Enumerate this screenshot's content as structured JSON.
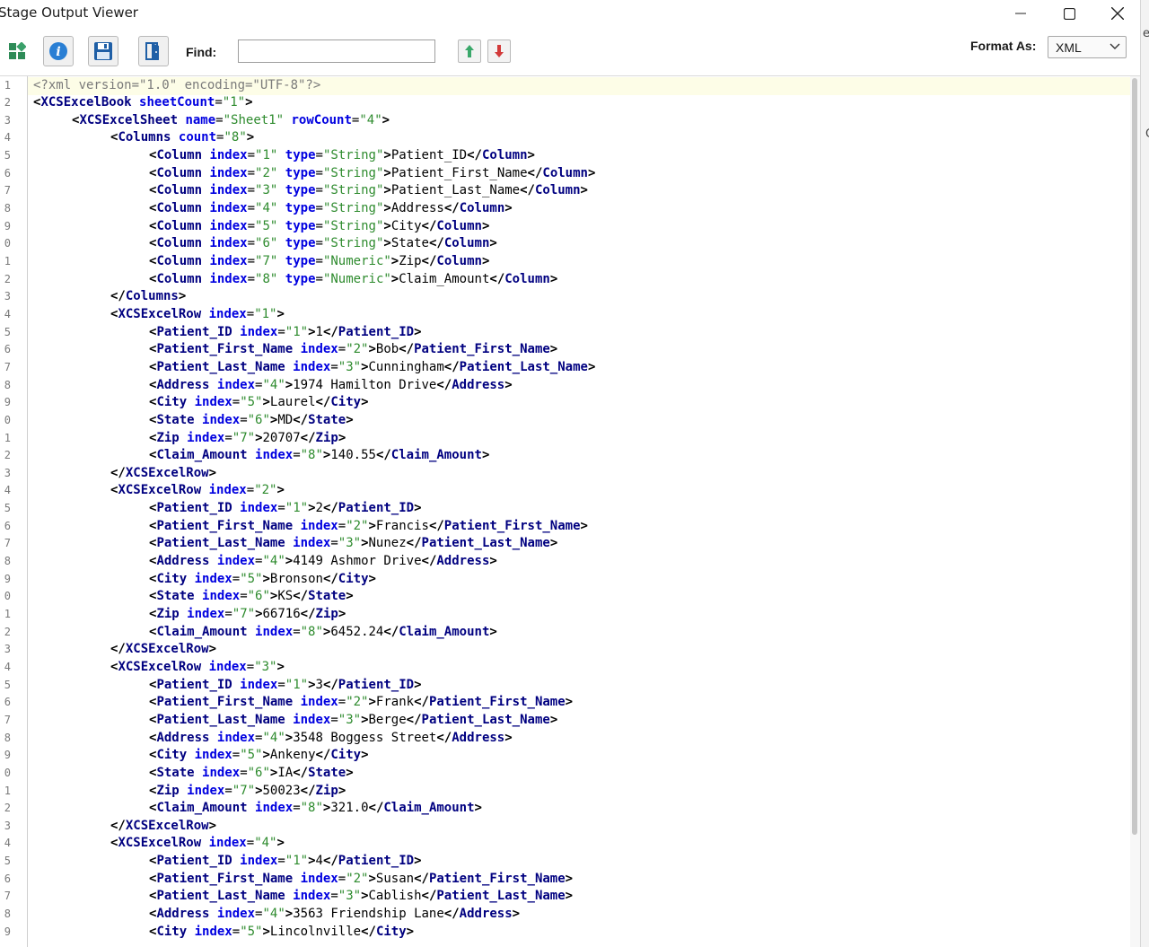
{
  "window": {
    "title": "Stage Output Viewer"
  },
  "toolbar": {
    "find_label": "Find:",
    "find_value": "",
    "format_label": "Format As:",
    "format_value": "XML"
  },
  "background_strip": [
    "e",
    "C"
  ],
  "colors": {
    "tag": "#000080",
    "attribute": "#0000e0",
    "value": "#2e8b2e",
    "declaration": "#7a7a7a",
    "current_line": "#fdfde7"
  },
  "editor": {
    "line_numbers": [
      "1",
      "2",
      "3",
      "4",
      "5",
      "6",
      "7",
      "8",
      "9",
      "0",
      "1",
      "2",
      "3",
      "4",
      "5",
      "6",
      "7",
      "8",
      "9",
      "0",
      "1",
      "2",
      "3",
      "4",
      "5",
      "6",
      "7",
      "8",
      "9",
      "0",
      "1",
      "2",
      "3",
      "4",
      "5",
      "6",
      "7",
      "8",
      "9",
      "0",
      "1",
      "2",
      "3",
      "4",
      "5",
      "6",
      "7",
      "8",
      "9"
    ],
    "lines": [
      {
        "indent": 0,
        "kind": "decl",
        "text": "<?xml version=\"1.0\" encoding=\"UTF-8\"?>"
      },
      {
        "indent": 0,
        "kind": "open",
        "tag": "XCSExcelBook",
        "attrs": [
          [
            "sheetCount",
            "1"
          ]
        ]
      },
      {
        "indent": 1,
        "kind": "open",
        "tag": "XCSExcelSheet",
        "attrs": [
          [
            "name",
            "Sheet1"
          ],
          [
            "rowCount",
            "4"
          ]
        ]
      },
      {
        "indent": 2,
        "kind": "open",
        "tag": "Columns",
        "attrs": [
          [
            "count",
            "8"
          ]
        ]
      },
      {
        "indent": 3,
        "kind": "elem",
        "tag": "Column",
        "attrs": [
          [
            "index",
            "1"
          ],
          [
            "type",
            "String"
          ]
        ],
        "text": "Patient_ID"
      },
      {
        "indent": 3,
        "kind": "elem",
        "tag": "Column",
        "attrs": [
          [
            "index",
            "2"
          ],
          [
            "type",
            "String"
          ]
        ],
        "text": "Patient_First_Name"
      },
      {
        "indent": 3,
        "kind": "elem",
        "tag": "Column",
        "attrs": [
          [
            "index",
            "3"
          ],
          [
            "type",
            "String"
          ]
        ],
        "text": "Patient_Last_Name"
      },
      {
        "indent": 3,
        "kind": "elem",
        "tag": "Column",
        "attrs": [
          [
            "index",
            "4"
          ],
          [
            "type",
            "String"
          ]
        ],
        "text": "Address"
      },
      {
        "indent": 3,
        "kind": "elem",
        "tag": "Column",
        "attrs": [
          [
            "index",
            "5"
          ],
          [
            "type",
            "String"
          ]
        ],
        "text": "City"
      },
      {
        "indent": 3,
        "kind": "elem",
        "tag": "Column",
        "attrs": [
          [
            "index",
            "6"
          ],
          [
            "type",
            "String"
          ]
        ],
        "text": "State"
      },
      {
        "indent": 3,
        "kind": "elem",
        "tag": "Column",
        "attrs": [
          [
            "index",
            "7"
          ],
          [
            "type",
            "Numeric"
          ]
        ],
        "text": "Zip"
      },
      {
        "indent": 3,
        "kind": "elem",
        "tag": "Column",
        "attrs": [
          [
            "index",
            "8"
          ],
          [
            "type",
            "Numeric"
          ]
        ],
        "text": "Claim_Amount"
      },
      {
        "indent": 2,
        "kind": "close",
        "tag": "Columns"
      },
      {
        "indent": 2,
        "kind": "open",
        "tag": "XCSExcelRow",
        "attrs": [
          [
            "index",
            "1"
          ]
        ]
      },
      {
        "indent": 3,
        "kind": "elem",
        "tag": "Patient_ID",
        "attrs": [
          [
            "index",
            "1"
          ]
        ],
        "text": "1"
      },
      {
        "indent": 3,
        "kind": "elem",
        "tag": "Patient_First_Name",
        "attrs": [
          [
            "index",
            "2"
          ]
        ],
        "text": "Bob"
      },
      {
        "indent": 3,
        "kind": "elem",
        "tag": "Patient_Last_Name",
        "attrs": [
          [
            "index",
            "3"
          ]
        ],
        "text": "Cunningham"
      },
      {
        "indent": 3,
        "kind": "elem",
        "tag": "Address",
        "attrs": [
          [
            "index",
            "4"
          ]
        ],
        "text": "1974 Hamilton Drive"
      },
      {
        "indent": 3,
        "kind": "elem",
        "tag": "City",
        "attrs": [
          [
            "index",
            "5"
          ]
        ],
        "text": "Laurel"
      },
      {
        "indent": 3,
        "kind": "elem",
        "tag": "State",
        "attrs": [
          [
            "index",
            "6"
          ]
        ],
        "text": "MD"
      },
      {
        "indent": 3,
        "kind": "elem",
        "tag": "Zip",
        "attrs": [
          [
            "index",
            "7"
          ]
        ],
        "text": "20707"
      },
      {
        "indent": 3,
        "kind": "elem",
        "tag": "Claim_Amount",
        "attrs": [
          [
            "index",
            "8"
          ]
        ],
        "text": "140.55"
      },
      {
        "indent": 2,
        "kind": "close",
        "tag": "XCSExcelRow"
      },
      {
        "indent": 2,
        "kind": "open",
        "tag": "XCSExcelRow",
        "attrs": [
          [
            "index",
            "2"
          ]
        ]
      },
      {
        "indent": 3,
        "kind": "elem",
        "tag": "Patient_ID",
        "attrs": [
          [
            "index",
            "1"
          ]
        ],
        "text": "2"
      },
      {
        "indent": 3,
        "kind": "elem",
        "tag": "Patient_First_Name",
        "attrs": [
          [
            "index",
            "2"
          ]
        ],
        "text": "Francis"
      },
      {
        "indent": 3,
        "kind": "elem",
        "tag": "Patient_Last_Name",
        "attrs": [
          [
            "index",
            "3"
          ]
        ],
        "text": "Nunez"
      },
      {
        "indent": 3,
        "kind": "elem",
        "tag": "Address",
        "attrs": [
          [
            "index",
            "4"
          ]
        ],
        "text": "4149 Ashmor Drive"
      },
      {
        "indent": 3,
        "kind": "elem",
        "tag": "City",
        "attrs": [
          [
            "index",
            "5"
          ]
        ],
        "text": "Bronson"
      },
      {
        "indent": 3,
        "kind": "elem",
        "tag": "State",
        "attrs": [
          [
            "index",
            "6"
          ]
        ],
        "text": "KS"
      },
      {
        "indent": 3,
        "kind": "elem",
        "tag": "Zip",
        "attrs": [
          [
            "index",
            "7"
          ]
        ],
        "text": "66716"
      },
      {
        "indent": 3,
        "kind": "elem",
        "tag": "Claim_Amount",
        "attrs": [
          [
            "index",
            "8"
          ]
        ],
        "text": "6452.24"
      },
      {
        "indent": 2,
        "kind": "close",
        "tag": "XCSExcelRow"
      },
      {
        "indent": 2,
        "kind": "open",
        "tag": "XCSExcelRow",
        "attrs": [
          [
            "index",
            "3"
          ]
        ]
      },
      {
        "indent": 3,
        "kind": "elem",
        "tag": "Patient_ID",
        "attrs": [
          [
            "index",
            "1"
          ]
        ],
        "text": "3"
      },
      {
        "indent": 3,
        "kind": "elem",
        "tag": "Patient_First_Name",
        "attrs": [
          [
            "index",
            "2"
          ]
        ],
        "text": "Frank"
      },
      {
        "indent": 3,
        "kind": "elem",
        "tag": "Patient_Last_Name",
        "attrs": [
          [
            "index",
            "3"
          ]
        ],
        "text": "Berge"
      },
      {
        "indent": 3,
        "kind": "elem",
        "tag": "Address",
        "attrs": [
          [
            "index",
            "4"
          ]
        ],
        "text": "3548 Boggess Street"
      },
      {
        "indent": 3,
        "kind": "elem",
        "tag": "City",
        "attrs": [
          [
            "index",
            "5"
          ]
        ],
        "text": "Ankeny"
      },
      {
        "indent": 3,
        "kind": "elem",
        "tag": "State",
        "attrs": [
          [
            "index",
            "6"
          ]
        ],
        "text": "IA"
      },
      {
        "indent": 3,
        "kind": "elem",
        "tag": "Zip",
        "attrs": [
          [
            "index",
            "7"
          ]
        ],
        "text": "50023"
      },
      {
        "indent": 3,
        "kind": "elem",
        "tag": "Claim_Amount",
        "attrs": [
          [
            "index",
            "8"
          ]
        ],
        "text": "321.0"
      },
      {
        "indent": 2,
        "kind": "close",
        "tag": "XCSExcelRow"
      },
      {
        "indent": 2,
        "kind": "open",
        "tag": "XCSExcelRow",
        "attrs": [
          [
            "index",
            "4"
          ]
        ]
      },
      {
        "indent": 3,
        "kind": "elem",
        "tag": "Patient_ID",
        "attrs": [
          [
            "index",
            "1"
          ]
        ],
        "text": "4"
      },
      {
        "indent": 3,
        "kind": "elem",
        "tag": "Patient_First_Name",
        "attrs": [
          [
            "index",
            "2"
          ]
        ],
        "text": "Susan"
      },
      {
        "indent": 3,
        "kind": "elem",
        "tag": "Patient_Last_Name",
        "attrs": [
          [
            "index",
            "3"
          ]
        ],
        "text": "Cablish"
      },
      {
        "indent": 3,
        "kind": "elem",
        "tag": "Address",
        "attrs": [
          [
            "index",
            "4"
          ]
        ],
        "text": "3563 Friendship Lane"
      },
      {
        "indent": 3,
        "kind": "elem",
        "tag": "City",
        "attrs": [
          [
            "index",
            "5"
          ]
        ],
        "text": "Lincolnville"
      }
    ]
  }
}
